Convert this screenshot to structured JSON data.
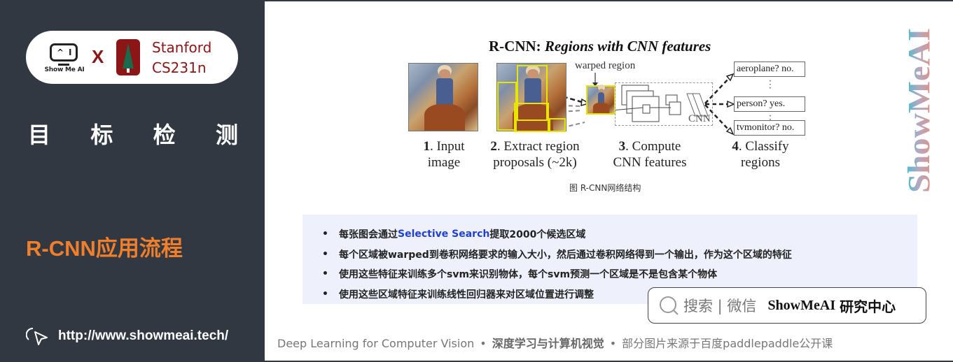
{
  "sidebar": {
    "logo": {
      "showmeai_eyes": "^ I",
      "showmeai_text": "Show Me AI",
      "x_mark": "X",
      "stanford_line1": "Stanford",
      "stanford_line2": "CS231n"
    },
    "title_chars": [
      "目",
      "标",
      "检",
      "测"
    ],
    "section_title": "R-CNN应用流程",
    "url": "http://www.showmeai.tech/",
    "url_icon": "cursor-click-icon"
  },
  "figure": {
    "title_prefix": "R-CNN: ",
    "title_italic": "Regions with CNN features",
    "warped_label": "warped region",
    "cnn_label": "CNN",
    "classes": [
      "aeroplane? no.",
      "person? yes.",
      "tvmonitor? no."
    ],
    "steps": [
      {
        "num": "1",
        "line1": ". Input",
        "line2": "image"
      },
      {
        "num": "2",
        "line1": ". Extract region",
        "line2": "proposals (~2k)"
      },
      {
        "num": "3",
        "line1": ". Compute",
        "line2": "CNN features"
      },
      {
        "num": "4",
        "line1": ". Classify",
        "line2": "regions"
      }
    ],
    "caption": "图 R-CNN网络结构"
  },
  "bullets": [
    {
      "before": "每张图会通过",
      "highlight": "Selective Search",
      "after": "提取2000个候选区域"
    },
    {
      "before": "每个区域被warped到卷积网络要求的输入大小，然后通过卷积网络得到一个输出，作为这个区域的特征",
      "highlight": "",
      "after": ""
    },
    {
      "before": "使用这些特征来训练多个svm来识别物体，每个svm预测一个区域是不是包含某个物体",
      "highlight": "",
      "after": ""
    },
    {
      "before": "使用这些区域特征来训练线性回归器来对区域位置进行调整",
      "highlight": "",
      "after": ""
    }
  ],
  "bullet_marker": "•",
  "search": {
    "hint": "搜索 | 微信",
    "brand": "ShowMeAI",
    "brand_cn": "研究中心"
  },
  "footer": {
    "en": "Deep Learning for Computer Vision",
    "sep": "•",
    "cn_bold": "深度学习与计算机视觉",
    "note": "部分图片来源于百度paddlepaddle公开课"
  },
  "watermark": "ShowMeAI",
  "colors": {
    "sidebar_bg": "#323842",
    "accent_orange": "#f07f2c",
    "stanford_red": "#8c1515",
    "highlight_blue": "#1f3fd8",
    "bullet_bg": "#eef0fb"
  }
}
